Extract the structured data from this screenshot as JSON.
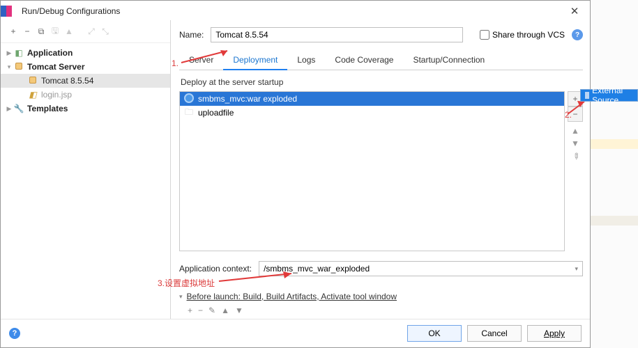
{
  "titlebar": {
    "title": "Run/Debug Configurations",
    "close_glyph": "✕"
  },
  "left_toolbar": {
    "plus": "+",
    "minus": "−",
    "copy": "⧉",
    "up_sep": "▲",
    "save": "🖫",
    "tree_expand": "⤢",
    "tree_collapse": "⤡"
  },
  "tree": {
    "application": "Application",
    "tomcat_server": "Tomcat Server",
    "tomcat_node": "Tomcat 8.5.54",
    "login": "login.jsp",
    "templates": "Templates"
  },
  "name_row": {
    "label": "Name:",
    "value": "Tomcat 8.5.54",
    "share_label": "Share through VCS"
  },
  "tabs": {
    "server": "Server",
    "deployment": "Deployment",
    "logs": "Logs",
    "code_coverage": "Code Coverage",
    "startup": "Startup/Connection"
  },
  "deploy": {
    "section_label": "Deploy at the server startup",
    "items": [
      {
        "name": "smbms_mvc:war exploded",
        "type": "war",
        "selected": true
      },
      {
        "name": "uploadfile",
        "type": "folder",
        "selected": false
      }
    ],
    "side": {
      "plus": "+",
      "minus": "−",
      "up": "▲",
      "down": "▼",
      "edit": "✎"
    },
    "popup": "External Source..."
  },
  "context": {
    "label": "Application context:",
    "value": "/smbms_mvc_war_exploded"
  },
  "before_launch": {
    "header": "Before launch: Build, Build Artifacts, Activate tool window",
    "toolbar": {
      "plus": "+",
      "minus": "−",
      "edit": "✎",
      "up": "▲",
      "down": "▼"
    }
  },
  "footer": {
    "ok": "OK",
    "cancel": "Cancel",
    "apply": "Apply"
  },
  "annotations": {
    "a1": "1.",
    "a2": "2.",
    "a3": "3.设置虚拟地址"
  }
}
